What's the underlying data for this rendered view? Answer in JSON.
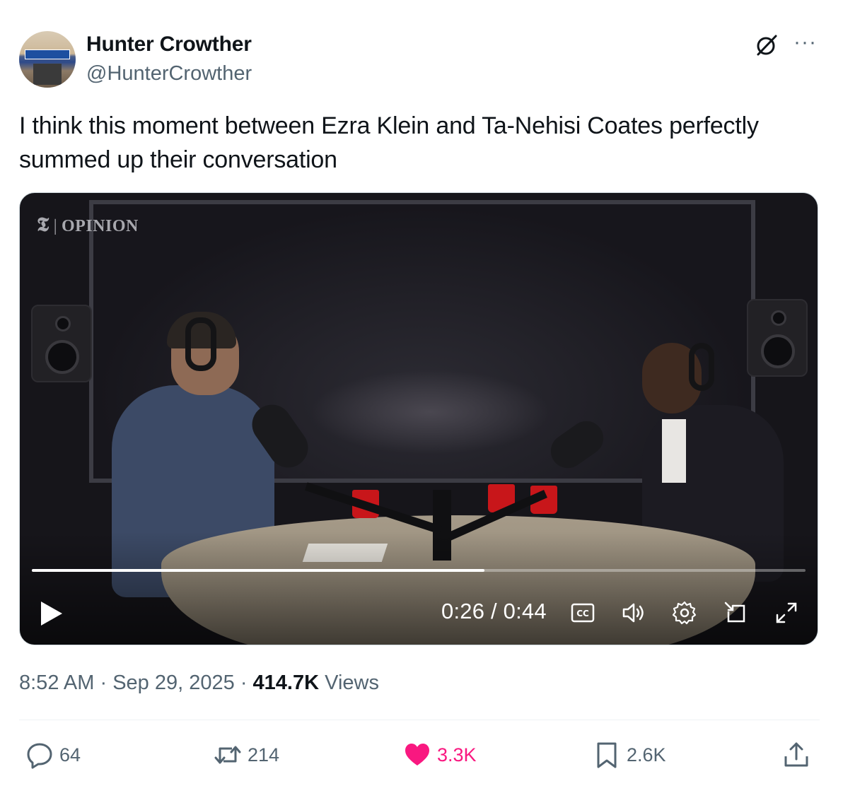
{
  "author": {
    "display_name": "Hunter Crowther",
    "handle": "@HunterCrowther",
    "avatar_icon": "storefront-avatar"
  },
  "tweet": {
    "text": "I think this moment between Ezra Klein and Ta-Nehisi Coates perfectly summed up their conversation"
  },
  "video": {
    "watermark_label": "OPINION",
    "current_time": "0:26",
    "separator": "/",
    "duration": "0:44",
    "progress_fraction": 0.585,
    "icons": [
      "play-icon",
      "captions-icon",
      "volume-icon",
      "settings-icon",
      "pop-out-icon",
      "fullscreen-icon"
    ]
  },
  "meta": {
    "time": "8:52 AM",
    "dot1": "·",
    "date": "Sep 29, 2025",
    "dot2": "·",
    "views_count": "414.7K",
    "views_label": "Views"
  },
  "actions": {
    "replies": "64",
    "reposts": "214",
    "likes": "3.3K",
    "bookmarks": "2.6K"
  },
  "colors": {
    "like_active": "#f91880",
    "secondary_text": "#536471",
    "primary_text": "#0f1419"
  }
}
